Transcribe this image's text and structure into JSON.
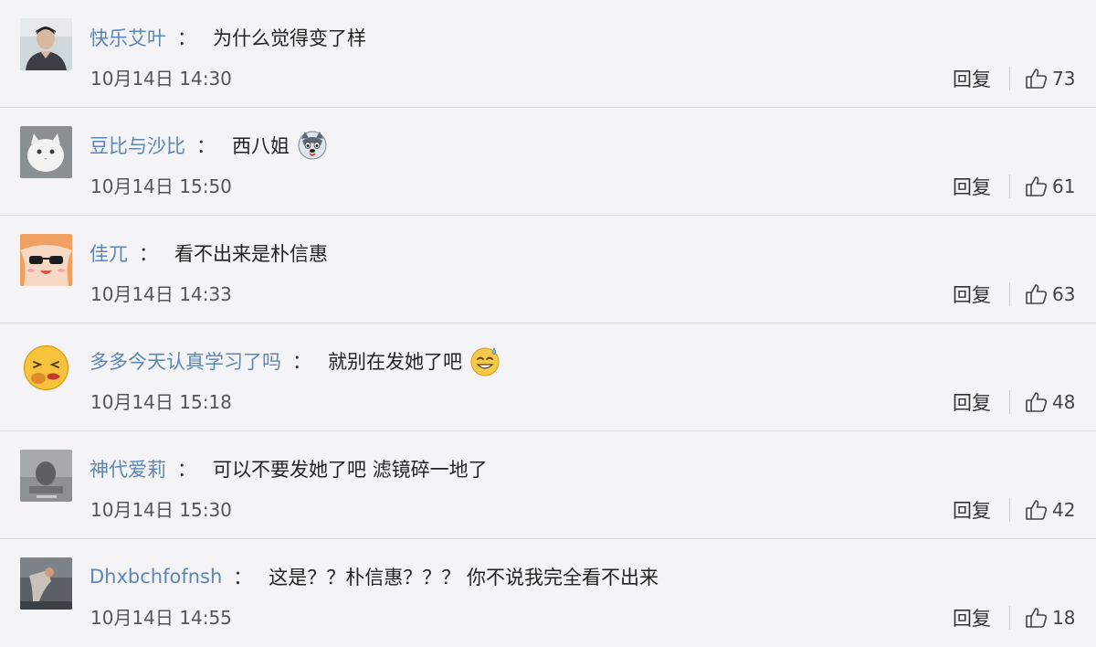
{
  "comments": [
    {
      "avatar_icon": "man-portrait-avatar",
      "username": "快乐艾叶",
      "colon": "：",
      "content": "为什么觉得变了样",
      "emoji": "",
      "time": "10月14日 14:30",
      "reply_label": "回复",
      "likes": "73"
    },
    {
      "avatar_icon": "white-cat-avatar",
      "username": "豆比与沙比",
      "colon": "：",
      "content": "西八姐",
      "emoji": "husky-dog-emoji",
      "time": "10月14日 15:50",
      "reply_label": "回复",
      "likes": "61"
    },
    {
      "avatar_icon": "anime-sunglasses-avatar",
      "username": "佳兀",
      "colon": "：",
      "content": "看不出来是朴信惠",
      "emoji": "",
      "time": "10月14日 14:33",
      "reply_label": "回复",
      "likes": "63"
    },
    {
      "avatar_icon": "yellow-face-avatar",
      "username": "多多今天认真学习了吗",
      "colon": "：",
      "content": "就别在发她了吧",
      "emoji": "sweat-smile-emoji",
      "time": "10月14日 15:18",
      "reply_label": "回复",
      "likes": "48"
    },
    {
      "avatar_icon": "gray-photo-avatar",
      "username": "神代爱莉",
      "colon": "：",
      "content": "可以不要发她了吧 滤镜碎一地了",
      "emoji": "",
      "time": "10月14日 15:30",
      "reply_label": "回复",
      "likes": "42"
    },
    {
      "avatar_icon": "dark-scene-avatar",
      "username": "Dhxbchfofnsh",
      "colon": "：",
      "content": "这是？？朴信惠？？？ 你不说我完全看不出来",
      "emoji": "",
      "time": "10月14日 14:55",
      "reply_label": "回复",
      "likes": "18"
    }
  ],
  "colors": {
    "background": "#f4f4f6",
    "username": "#5a86b8",
    "divider": "#dcdcdc"
  }
}
